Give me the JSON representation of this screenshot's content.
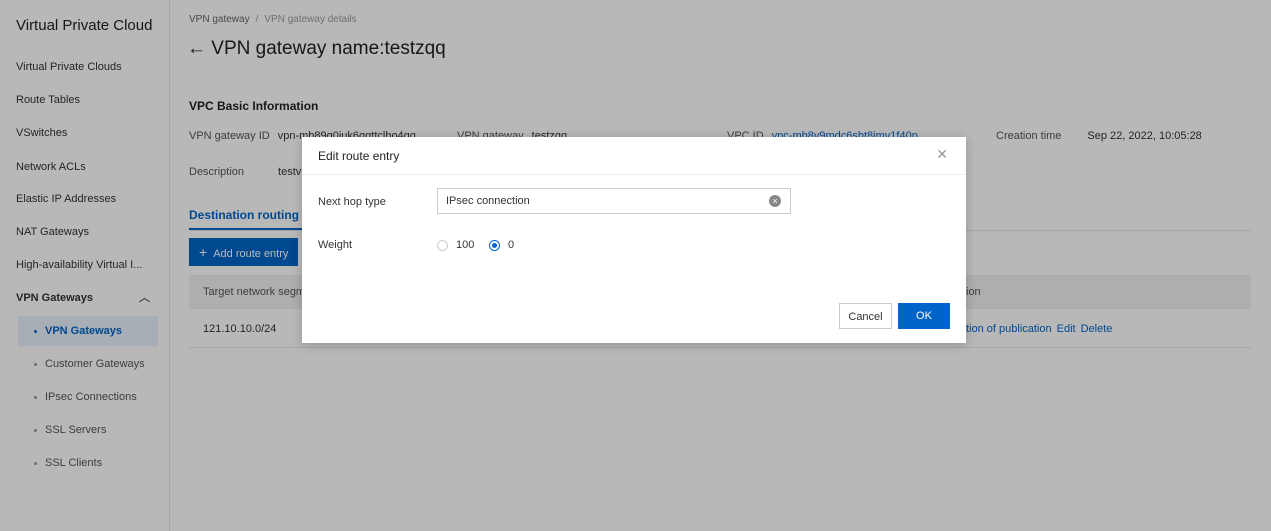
{
  "sidebar": {
    "title": "Virtual Private Cloud",
    "items": [
      {
        "label": "Virtual Private Clouds"
      },
      {
        "label": "Route Tables"
      },
      {
        "label": "VSwitches"
      },
      {
        "label": "Network ACLs"
      },
      {
        "label": "Elastic IP Addresses"
      },
      {
        "label": "NAT Gateways"
      },
      {
        "label": "High-availability Virtual I..."
      },
      {
        "label": "VPN Gateways"
      }
    ],
    "sub_items": [
      {
        "label": "VPN Gateways",
        "active": true
      },
      {
        "label": "Customer Gateways"
      },
      {
        "label": "IPsec Connections"
      },
      {
        "label": "SSL Servers"
      },
      {
        "label": "SSL Clients"
      }
    ]
  },
  "breadcrumb": {
    "parent": "VPN gateway",
    "separator": "/",
    "current": "VPN gateway details"
  },
  "page": {
    "title": "VPN gateway name:testzqq",
    "section_title": "VPC Basic Information",
    "info": {
      "gateway_id_label": "VPN gateway ID",
      "gateway_id_value": "vpn-mb89q0iuk6qqttclho4qq",
      "gateway_label": "VPN gateway",
      "gateway_value": "testzqq",
      "vpc_id_label": "VPC ID",
      "vpc_id_value": "vpc-mb8y9mdc6sbt8imv1f40p",
      "creation_label": "Creation time",
      "creation_value": "Sep 22, 2022, 10:05:28",
      "description_label": "Description",
      "description_value": "testvp"
    },
    "tab_label": "Destination routing ta",
    "add_button": "Add route entry",
    "table": {
      "col_target": "Target network segme",
      "col_action": "ion",
      "rows": [
        {
          "target": "121.10.10.0/24",
          "actions": [
            "tion of publication",
            "Edit",
            "Delete"
          ]
        }
      ]
    }
  },
  "dialog": {
    "title": "Edit route entry",
    "next_hop_label": "Next hop type",
    "next_hop_value": "IPsec connection",
    "weight_label": "Weight",
    "weight_options": [
      "100",
      "0"
    ],
    "weight_selected": "0",
    "cancel": "Cancel",
    "ok": "OK"
  },
  "colors": {
    "accent": "#0064c8",
    "overlay": "rgba(0,0,0,0.28)"
  },
  "icons": {
    "back": "arrow-left-icon",
    "close": "close-icon",
    "clear": "clear-circle-icon",
    "collapse": "chevron-up-icon"
  }
}
